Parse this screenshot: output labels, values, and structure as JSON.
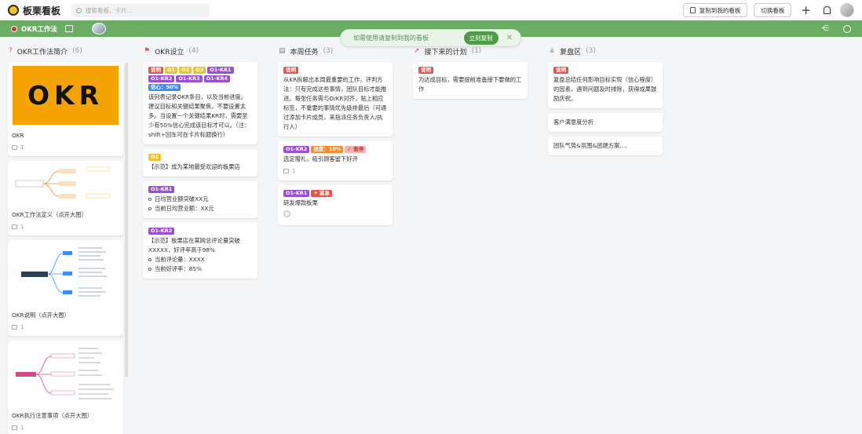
{
  "app": {
    "name": "板栗看板",
    "search_placeholder": "搜索看板、卡片..."
  },
  "topbar": {
    "copy_button": "复制到我的看板",
    "switch_button": "切换看板"
  },
  "board": {
    "title": "OKR工作法"
  },
  "toast": {
    "text": "如需使用请复制到我的看板",
    "action": "立刻复制"
  },
  "columns": [
    {
      "title": "OKR工作法简介",
      "count": "(6)",
      "cards": [
        {
          "image_text": "OKR",
          "title": "OKR",
          "comments": "1"
        },
        {
          "title": "OKR工作法定义（点开大图）",
          "comments": "1"
        },
        {
          "title": "OKR说明（点开大图）",
          "comments": "1"
        },
        {
          "title": "OKR执行注意事项（点开大图）",
          "comments": "1"
        }
      ]
    },
    {
      "title": "OKR设立",
      "count": "(4)",
      "cards": [
        {
          "tags": [
            "说明",
            "O1",
            "O2",
            "O3",
            "O1-KR1",
            "O1-KR2",
            "O1-KR3",
            "O1-KR4",
            "信心：50%"
          ],
          "text": "该列表记录OKR条目，以及当前进度。建议目标和关键结果聚焦，不要设置太多。当设置一个关键结果KR时，需要至少有50%信心完成该目标才可以。（注：shift+回车可在卡片标题换行）"
        },
        {
          "tags": [
            "O1"
          ],
          "text": "【示范】成为某地最受欢迎的板栗店"
        },
        {
          "tags": [
            "O1-KR1"
          ],
          "lines": [
            "日均营业额突破XX元",
            "当前日均营业额：XX元"
          ]
        },
        {
          "tags": [
            "O1-KR2"
          ],
          "text": "【示范】板栗店在某网总评论量突破XXXXX，好评率高于98%",
          "lines": [
            "当前评论量：XXXX",
            "当前好评率：85%"
          ]
        }
      ]
    },
    {
      "title": "本周任务",
      "count": "(3)",
      "cards": [
        {
          "tags": [
            "说明"
          ],
          "text": "从KR拆解出本周最重要的工作。评判方法：只有完成这些事情，团队目标才能推进。每张任务需与O/KR对齐，贴上相应标签，不重要的事情优先级排最后（可通过添加卡片成员，来指派任务负责人/执行人）"
        },
        {
          "tags": [
            "O1-KR2",
            "进度：10%",
            "✓ 暂停"
          ],
          "text": "选定赠礼，吸引顾客留下好评",
          "comments": "1"
        },
        {
          "tags": [
            "O1-KR1",
            "✦ 紧急"
          ],
          "text": "研发爆款板栗"
        }
      ]
    },
    {
      "title": "接下来的计划",
      "count": "(1)",
      "cards": [
        {
          "tags": [
            "说明"
          ],
          "text": "为达成目标，需要提前准备接下要做的工作"
        }
      ]
    },
    {
      "title": "复盘区",
      "count": "(3)",
      "cards": [
        {
          "tags": [
            "说明"
          ],
          "text": "复盘总结任何影响目标实现（信心程度）的因素，遇到问题及时排除，获得成果鼓励庆祝。"
        },
        {
          "text": "客户满意度分析"
        },
        {
          "text": "团队气势&氛围&团建方案...."
        }
      ]
    }
  ]
}
